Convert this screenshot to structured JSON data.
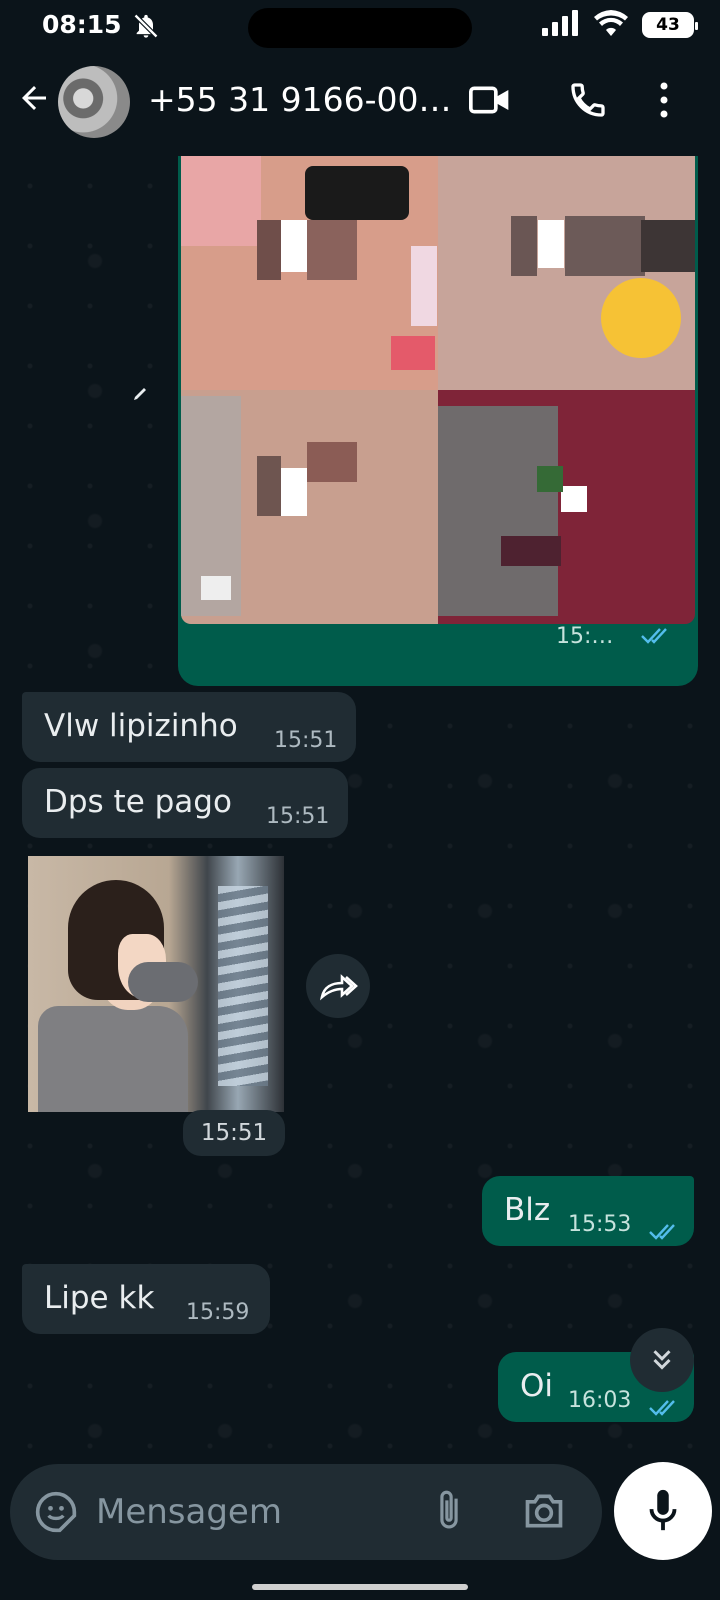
{
  "status_bar": {
    "time": "08:15",
    "battery": "43"
  },
  "header": {
    "contact": "+55 31 9166-00…"
  },
  "messages": [
    {
      "side": "in",
      "text": "Vlw lipizinho",
      "time": "15:51"
    },
    {
      "side": "in",
      "text": "Dps te pago",
      "time": "15:51"
    },
    {
      "side": "in",
      "text": "",
      "time": "15:51",
      "type": "image"
    },
    {
      "side": "out",
      "text": "Blz",
      "time": "15:53"
    },
    {
      "side": "in",
      "text": "Lipe kk",
      "time": "15:59"
    },
    {
      "side": "out",
      "text": "Oi",
      "time": "16:03"
    }
  ],
  "composer": {
    "placeholder": "Mensagem"
  },
  "colors": {
    "incoming": "#202c33",
    "outgoing": "#005c4b",
    "tick_read": "#53bdeb"
  }
}
